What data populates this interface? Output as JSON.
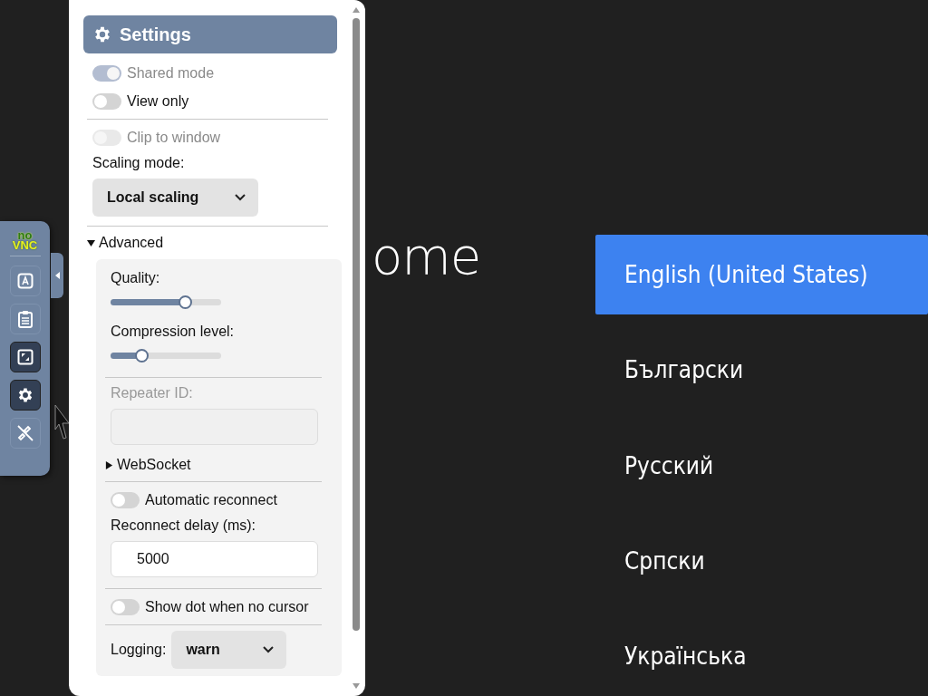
{
  "background": {
    "heading": "ome",
    "languages": [
      {
        "label": "English (United States)",
        "selected": true
      },
      {
        "label": "Български",
        "selected": false
      },
      {
        "label": "Русский",
        "selected": false
      },
      {
        "label": "Српски",
        "selected": false
      },
      {
        "label": "Українська",
        "selected": false
      }
    ]
  },
  "control_bar": {
    "logo": {
      "top": "no",
      "bottom": "VNC"
    },
    "buttons": [
      {
        "kind": "keyboard",
        "selected": false
      },
      {
        "kind": "clipboard",
        "selected": false
      },
      {
        "kind": "fullscreen",
        "selected": true
      },
      {
        "kind": "settings",
        "selected": true
      },
      {
        "kind": "disconnect",
        "selected": false
      }
    ]
  },
  "settings": {
    "title": "Settings",
    "items": [
      {
        "kind": "toggle",
        "label": "Shared mode",
        "on": true,
        "disabled": true
      },
      {
        "kind": "toggle",
        "label": "View only",
        "on": false,
        "disabled": false
      },
      {
        "kind": "divider"
      },
      {
        "kind": "toggle",
        "label": "Clip to window",
        "on": false,
        "disabled": true
      },
      {
        "kind": "label",
        "label": "Scaling mode:"
      },
      {
        "kind": "select",
        "value": "Local scaling"
      },
      {
        "kind": "divider"
      },
      {
        "kind": "details",
        "label": "Advanced",
        "expanded": true,
        "children": [
          {
            "kind": "slider",
            "label": "Quality:",
            "level": 0.67
          },
          {
            "kind": "slider",
            "label": "Compression level:",
            "level": 0.28
          },
          {
            "kind": "divider"
          },
          {
            "kind": "field",
            "label": "Repeater ID:",
            "disabled": true
          },
          {
            "kind": "details",
            "label": "WebSocket",
            "expanded": false
          },
          {
            "kind": "divider"
          },
          {
            "kind": "toggle",
            "label": "Automatic reconnect",
            "on": false,
            "disabled": false
          },
          {
            "kind": "label",
            "label": "Reconnect delay (ms):"
          },
          {
            "kind": "input",
            "value": "5000"
          },
          {
            "kind": "divider"
          },
          {
            "kind": "toggle",
            "label": "Show dot when no cursor",
            "on": false,
            "disabled": false
          },
          {
            "kind": "divider"
          },
          {
            "kind": "inline_select",
            "label": "Logging:",
            "value": "warn"
          }
        ]
      }
    ]
  }
}
